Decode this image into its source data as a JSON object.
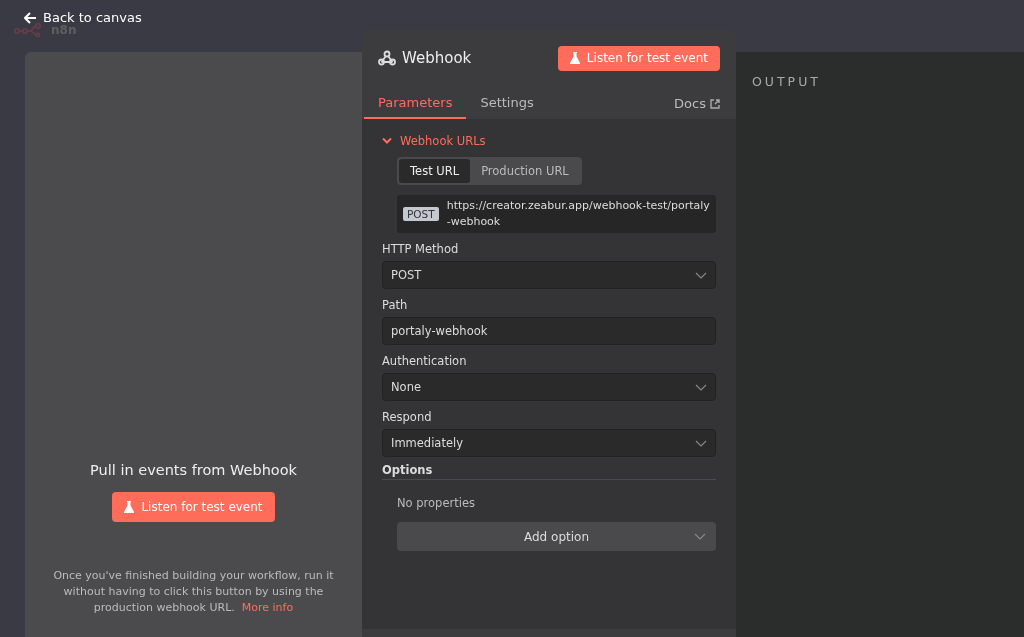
{
  "top_bar": {
    "back_link": "Back to canvas",
    "logo_text": "n8n"
  },
  "input_panel": {
    "title": "Pull in events from Webhook",
    "button": "Listen for test event",
    "hint": "Once you've finished building your workflow, run it without having to click this button by using the production webhook URL.",
    "hint_link": "More info"
  },
  "node_panel": {
    "title": "Webhook",
    "listen_button": "Listen for test event",
    "tabs": [
      {
        "label": "Parameters",
        "selected": true
      },
      {
        "label": "Settings",
        "selected": false
      }
    ],
    "docs_link": "Docs",
    "urls_section": {
      "title": "Webhook URLs",
      "expanded": true,
      "url_tabs": [
        {
          "label": "Test URL",
          "selected": true
        },
        {
          "label": "Production URL",
          "selected": false
        }
      ],
      "method_badge": "POST",
      "url": "https://creator.zeabur.app/webhook-test/portaly-webhook"
    },
    "fields": [
      {
        "label": "HTTP Method",
        "kind": "select",
        "value": "POST"
      },
      {
        "label": "Path",
        "kind": "text",
        "value": "portaly-webhook"
      },
      {
        "label": "Authentication",
        "kind": "select",
        "value": "None"
      },
      {
        "label": "Respond",
        "kind": "select",
        "value": "Immediately"
      }
    ],
    "options": {
      "title": "Options",
      "empty_text": "No properties",
      "add_button": "Add option"
    }
  },
  "output_panel": {
    "title": "OUTPUT"
  }
}
